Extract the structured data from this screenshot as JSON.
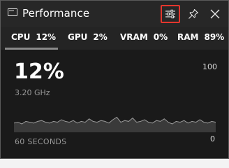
{
  "window": {
    "title": "Performance"
  },
  "titlebar": {
    "buttons": [
      "options",
      "pin",
      "close"
    ]
  },
  "tabs": [
    {
      "label": "CPU",
      "value": "12%"
    },
    {
      "label": "GPU",
      "value": "2%"
    },
    {
      "label": "VRAM",
      "value": "0%"
    },
    {
      "label": "RAM",
      "value": "89%"
    }
  ],
  "selected_tab": "CPU",
  "main": {
    "value": "12%",
    "frequency": "3.20 GHz",
    "axis_max": "100",
    "axis_min": "0",
    "time_span": "60 SECONDS"
  },
  "graph_samples": [
    11,
    12,
    10,
    13,
    12,
    11,
    13,
    14,
    12,
    11,
    13,
    12,
    15,
    13,
    12,
    14,
    11,
    13,
    12,
    16,
    13,
    12,
    14,
    13,
    11,
    15,
    18,
    12,
    14,
    13,
    17,
    12,
    13,
    15,
    12,
    11,
    14,
    13,
    16,
    12,
    10,
    13,
    12,
    14,
    11,
    13,
    12,
    15,
    12,
    11,
    13,
    12
  ],
  "colors": {
    "background": "#1a1a1a",
    "titlebar": "#272727",
    "highlight": "#e3362d",
    "graph_fill": "#3a3a3a",
    "graph_line": "#9a9a9a"
  }
}
